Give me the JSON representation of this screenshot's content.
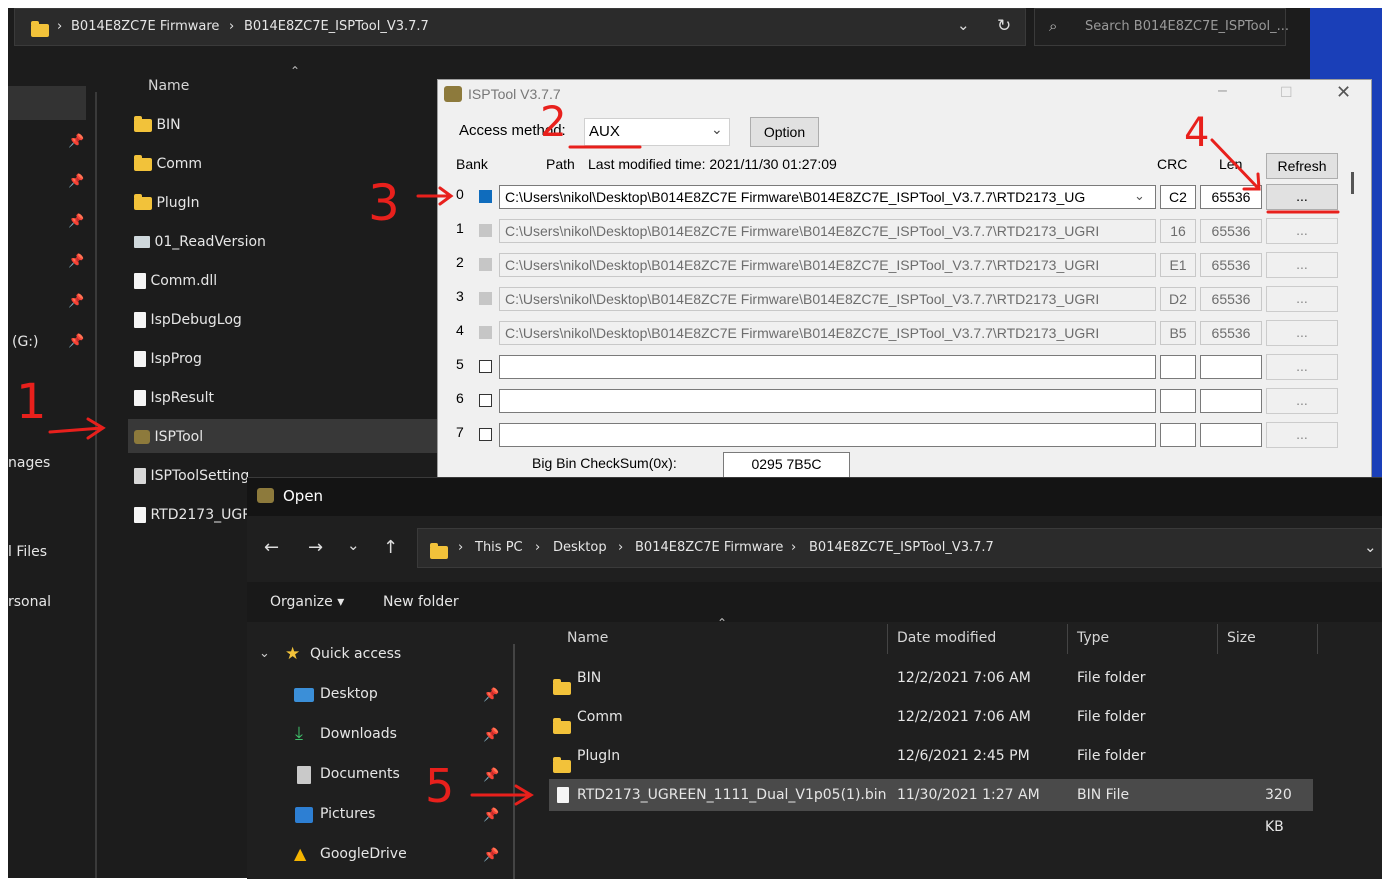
{
  "explorer": {
    "breadcrumb": [
      "B014E8ZC7E Firmware",
      "B014E8ZC7E_ISPTool_V3.7.7"
    ],
    "search_placeholder": "Search B014E8ZC7E_ISPTool_...",
    "column_name": "Name",
    "left_nav": {
      "drive": "(G:)",
      "images": "nages",
      "files": "l Files",
      "personal": "rsonal"
    },
    "items": [
      {
        "name": "BIN",
        "icon": "folder-icon"
      },
      {
        "name": "Comm",
        "icon": "folder-icon"
      },
      {
        "name": "PlugIn",
        "icon": "folder-icon"
      },
      {
        "name": "01_ReadVersion",
        "icon": "shortcut-icon"
      },
      {
        "name": "Comm.dll",
        "icon": "dll-icon"
      },
      {
        "name": "IspDebugLog",
        "icon": "text-file-icon"
      },
      {
        "name": "IspProg",
        "icon": "text-file-icon"
      },
      {
        "name": "IspResult",
        "icon": "text-file-icon"
      },
      {
        "name": "ISPTool",
        "icon": "app-icon"
      },
      {
        "name": "ISPToolSetting",
        "icon": "settings-file-icon"
      },
      {
        "name": "RTD2173_UGR",
        "icon": "file-icon"
      }
    ]
  },
  "isp": {
    "title": "ISPTool V3.7.7",
    "access_label": "Access method:",
    "access_value": "AUX",
    "option_button": "Option",
    "bank_header": "Bank",
    "path_header": "Path",
    "last_modified": "Last modified time: 2021/11/30 01:27:09",
    "crc_header": "CRC",
    "len_header": "Len",
    "refresh_button": "Refresh",
    "browse_label": "...",
    "banks": [
      {
        "num": "0",
        "checked": true,
        "path": "C:\\Users\\nikol\\Desktop\\B014E8ZC7E Firmware\\B014E8ZC7E_ISPTool_V3.7.7\\RTD2173_UG",
        "crc": "C2",
        "len": "65536"
      },
      {
        "num": "1",
        "checked": false,
        "path": "C:\\Users\\nikol\\Desktop\\B014E8ZC7E Firmware\\B014E8ZC7E_ISPTool_V3.7.7\\RTD2173_UGRI",
        "crc": "16",
        "len": "65536"
      },
      {
        "num": "2",
        "checked": false,
        "path": "C:\\Users\\nikol\\Desktop\\B014E8ZC7E Firmware\\B014E8ZC7E_ISPTool_V3.7.7\\RTD2173_UGRI",
        "crc": "E1",
        "len": "65536"
      },
      {
        "num": "3",
        "checked": false,
        "path": "C:\\Users\\nikol\\Desktop\\B014E8ZC7E Firmware\\B014E8ZC7E_ISPTool_V3.7.7\\RTD2173_UGRI",
        "crc": "D2",
        "len": "65536"
      },
      {
        "num": "4",
        "checked": false,
        "path": "C:\\Users\\nikol\\Desktop\\B014E8ZC7E Firmware\\B014E8ZC7E_ISPTool_V3.7.7\\RTD2173_UGRI",
        "crc": "B5",
        "len": "65536"
      },
      {
        "num": "5",
        "checked": false,
        "path": "",
        "crc": "",
        "len": ""
      },
      {
        "num": "6",
        "checked": false,
        "path": "",
        "crc": "",
        "len": ""
      },
      {
        "num": "7",
        "checked": false,
        "path": "",
        "crc": "",
        "len": ""
      }
    ],
    "checksum_label": "Big Bin CheckSum(0x):",
    "checksum_value": "0295 7B5C"
  },
  "open_dialog": {
    "title": "Open",
    "breadcrumb": [
      "This PC",
      "Desktop",
      "B014E8ZC7E Firmware",
      "B014E8ZC7E_ISPTool_V3.7.7"
    ],
    "organize": "Organize",
    "new_folder": "New folder",
    "nav": [
      {
        "label": "Quick access",
        "icon": "star-icon"
      },
      {
        "label": "Desktop",
        "icon": "desktop-icon"
      },
      {
        "label": "Downloads",
        "icon": "download-icon"
      },
      {
        "label": "Documents",
        "icon": "documents-icon"
      },
      {
        "label": "Pictures",
        "icon": "pictures-icon"
      },
      {
        "label": "GoogleDrive",
        "icon": "google-drive-icon"
      }
    ],
    "columns": {
      "name": "Name",
      "date": "Date modified",
      "type": "Type",
      "size": "Size"
    },
    "files": [
      {
        "name": "BIN",
        "date": "12/2/2021 7:06 AM",
        "type": "File folder",
        "size": ""
      },
      {
        "name": "Comm",
        "date": "12/2/2021 7:06 AM",
        "type": "File folder",
        "size": ""
      },
      {
        "name": "PlugIn",
        "date": "12/6/2021 2:45 PM",
        "type": "File folder",
        "size": ""
      },
      {
        "name": "RTD2173_UGREEN_1111_Dual_V1p05(1).bin",
        "date": "11/30/2021 1:27 AM",
        "type": "BIN File",
        "size": "320 KB"
      }
    ]
  },
  "annotations": [
    "1",
    "2",
    "3",
    "4",
    "5"
  ],
  "colors": {
    "annotation": "#e8201c",
    "accent": "#0f6cbd",
    "explorer_bg": "#1c1c1c",
    "dialog_bg": "#f0f0f0"
  }
}
